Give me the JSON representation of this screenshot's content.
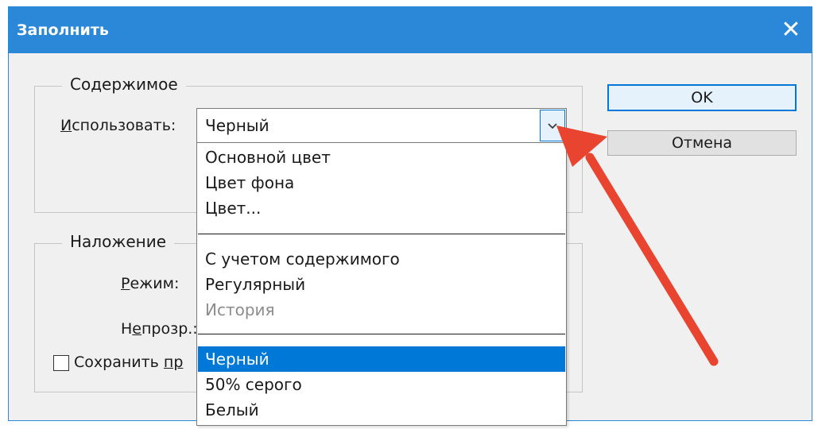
{
  "window": {
    "title": "Заполнить",
    "close_glyph": "✕"
  },
  "content_group": {
    "legend": "Содержимое",
    "use_label_prefix": "И",
    "use_label_rest": "спользовать:",
    "use_value": "Черный"
  },
  "blending_group": {
    "legend": "Наложение",
    "mode_label_prefix": "Р",
    "mode_label_rest": "ежим:",
    "opacity_label_a": "Н",
    "opacity_label_b": "е",
    "opacity_label_c": "прозр.:",
    "preserve_label_a": "Сохранить ",
    "preserve_label_b": "пр"
  },
  "buttons": {
    "ok": "OK",
    "cancel": "Отмена"
  },
  "dropdown": {
    "options": [
      {
        "label": "Основной цвет",
        "disabled": false
      },
      {
        "label": "Цвет фона",
        "disabled": false
      },
      {
        "label": "Цвет...",
        "disabled": false
      },
      {
        "label": "С учетом содержимого",
        "disabled": false
      },
      {
        "label": "Регулярный",
        "disabled": false
      },
      {
        "label": "История",
        "disabled": true
      },
      {
        "label": "Черный",
        "selected": true
      },
      {
        "label": "50% серого",
        "disabled": false
      },
      {
        "label": "Белый",
        "disabled": false
      }
    ]
  },
  "colors": {
    "titlebar": "#2b88d8",
    "selection": "#0078d7",
    "annotation_arrow": "#e8442f"
  },
  "icons": {
    "close": "close-icon",
    "dropdown": "chevron-down-icon",
    "annotation": "red-arrow-annotation"
  }
}
